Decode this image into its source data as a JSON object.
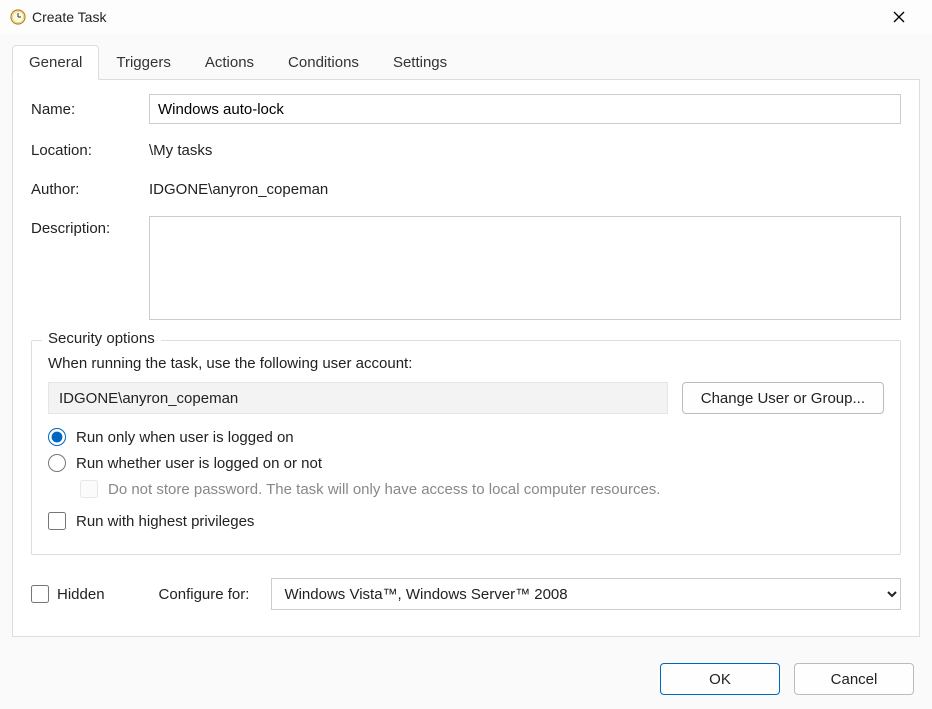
{
  "window": {
    "title": "Create Task"
  },
  "tabs": {
    "general": "General",
    "triggers": "Triggers",
    "actions": "Actions",
    "conditions": "Conditions",
    "settings": "Settings"
  },
  "general": {
    "labels": {
      "name": "Name:",
      "location": "Location:",
      "author": "Author:",
      "description": "Description:"
    },
    "name_value": "Windows auto-lock",
    "location_value": "\\My tasks",
    "author_value": "IDGONE\\anyron_copeman",
    "description_value": ""
  },
  "security": {
    "legend": "Security options",
    "when_running": "When running the task, use the following user account:",
    "account": "IDGONE\\anyron_copeman",
    "change_user_btn": "Change User or Group...",
    "radio_logged_on": "Run only when user is logged on",
    "radio_whether": "Run whether user is logged on or not",
    "no_store_pw": "Do not store password.  The task will only have access to local computer resources.",
    "highest_priv": "Run with highest privileges"
  },
  "bottom": {
    "hidden_label": "Hidden",
    "configure_label": "Configure for:",
    "configure_value": "Windows Vista™, Windows Server™ 2008"
  },
  "buttons": {
    "ok": "OK",
    "cancel": "Cancel"
  }
}
